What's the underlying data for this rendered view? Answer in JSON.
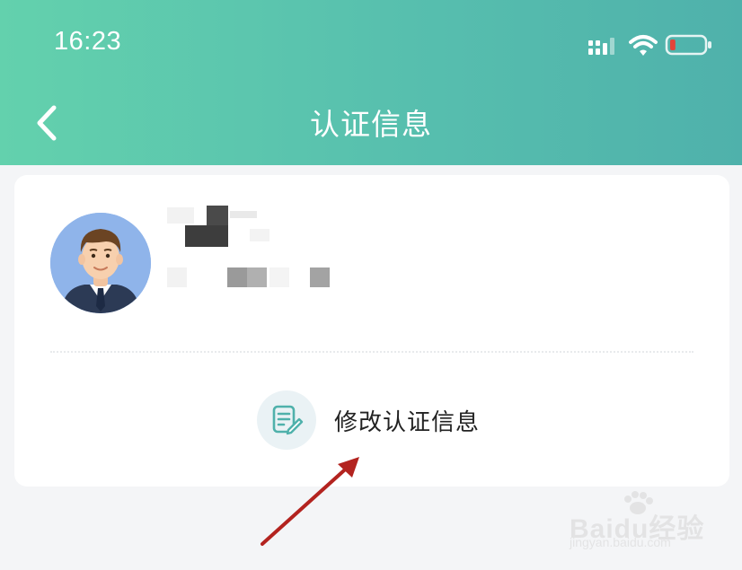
{
  "status_bar": {
    "time": "16:23",
    "signal_icon": "cellular-signal-icon",
    "wifi_icon": "wifi-icon",
    "battery_icon": "battery-low-icon",
    "battery_level_fraction": 0.12,
    "battery_color": "#e2443a"
  },
  "nav": {
    "title": "认证信息",
    "back_icon": "chevron-left-icon"
  },
  "profile": {
    "avatar_icon": "user-avatar-icon",
    "name": "",
    "detail": ""
  },
  "actions": {
    "edit_label": "修改认证信息",
    "edit_icon": "edit-document-icon"
  },
  "watermark": {
    "brand": "Baidu经验",
    "url": "jingyan.baidu.com"
  },
  "colors": {
    "header_gradient_start": "#63d1ad",
    "header_gradient_end": "#4fb1ab",
    "background": "#f4f5f7",
    "card": "#ffffff",
    "edit_icon_bg": "#eaf2f5",
    "accent": "#4fb1ab",
    "annotation_arrow": "#b3231f"
  }
}
